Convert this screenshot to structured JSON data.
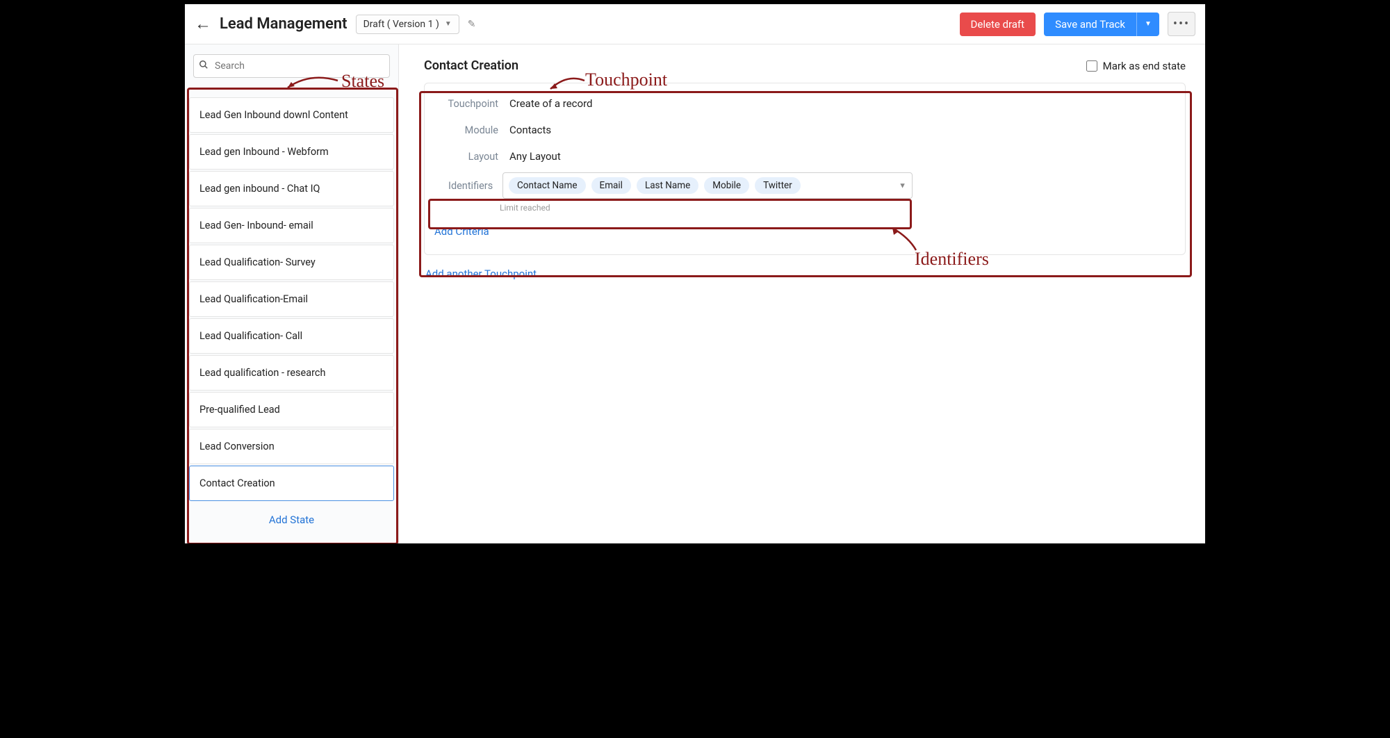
{
  "header": {
    "title": "Lead Management",
    "version_label": "Draft ( Version 1 )",
    "delete_label": "Delete draft",
    "save_label": "Save and Track"
  },
  "sidebar": {
    "search_placeholder": "Search",
    "states": [
      "Lead Gen Inbound downl Content",
      "Lead gen Inbound - Webform",
      "Lead gen inbound - Chat IQ",
      "Lead Gen- Inbound- email",
      "Lead Qualification- Survey",
      "Lead Qualification-Email",
      "Lead Qualification- Call",
      "Lead qualification - research",
      "Pre-qualified Lead",
      "Lead Conversion",
      "Contact Creation"
    ],
    "add_state_label": "Add State"
  },
  "main": {
    "title": "Contact Creation",
    "end_state_label": "Mark as end state",
    "touchpoint": {
      "labels": {
        "touchpoint": "Touchpoint",
        "module": "Module",
        "layout": "Layout",
        "identifiers": "Identifiers"
      },
      "values": {
        "touchpoint": "Create of a record",
        "module": "Contacts",
        "layout": "Any Layout"
      },
      "identifiers": [
        "Contact Name",
        "Email",
        "Last Name",
        "Mobile",
        "Twitter"
      ],
      "limit_text": "Limit reached",
      "add_criteria_label": "Add Criteria"
    },
    "add_touchpoint_label": "Add another Touchpoint"
  },
  "annotations": {
    "states": "States",
    "touchpoint": "Touchpoint",
    "identifiers": "Identifiers"
  }
}
